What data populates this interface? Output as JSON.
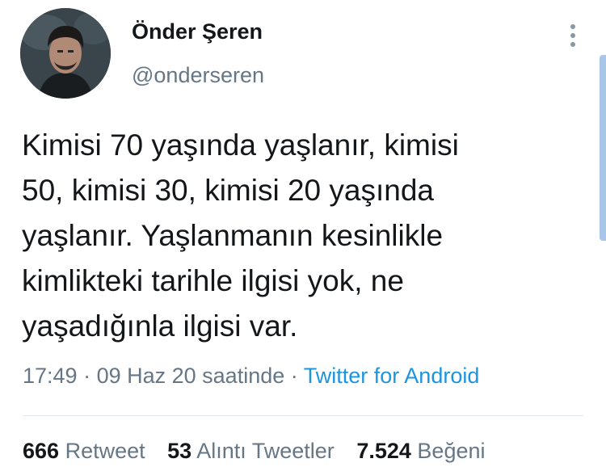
{
  "user": {
    "display_name": "Önder Şeren",
    "handle": "@onderseren",
    "avatar": "profile-photo"
  },
  "tweet": {
    "lines": [
      "Kimisi 70 yaşında yaşlanır, kimisi",
      "50, kimisi 30, kimisi 20 yaşında",
      "yaşlanır. Yaşlanmanın kesinlikle",
      "kimlikteki tarihle ilgisi yok, ne",
      "yaşadığınla ilgisi var."
    ]
  },
  "meta": {
    "time": "17:49",
    "separator": " · ",
    "date": "09 Haz 20 saatinde",
    "source": "Twitter for Android"
  },
  "stats": {
    "retweets": {
      "count": "666",
      "label": "Retweet"
    },
    "quotes": {
      "count": "53",
      "label": "Alıntı Tweetler"
    },
    "likes": {
      "count": "7.524",
      "label": "Beğeni"
    }
  },
  "icons": {
    "more": "more-vertical-icon"
  },
  "colors": {
    "text": "#14171a",
    "secondary": "#657786",
    "link": "#1b95e0",
    "divider": "#e1e8ed"
  }
}
